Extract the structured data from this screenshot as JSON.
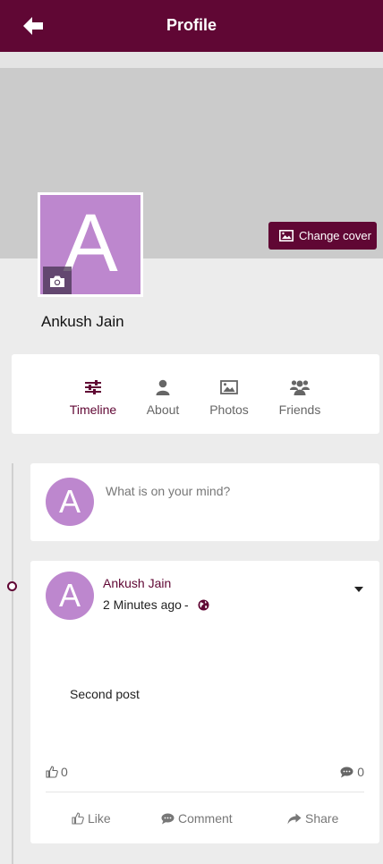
{
  "appbar": {
    "title": "Profile"
  },
  "cover": {
    "change_cover_label": "Change cover"
  },
  "profile": {
    "avatar_letter": "A",
    "name": "Ankush Jain"
  },
  "tabs": [
    {
      "label": "Timeline",
      "icon": "sliders-icon",
      "active": true
    },
    {
      "label": "About",
      "icon": "user-icon",
      "active": false
    },
    {
      "label": "Photos",
      "icon": "image-icon",
      "active": false
    },
    {
      "label": "Friends",
      "icon": "users-icon",
      "active": false
    }
  ],
  "composer": {
    "avatar_letter": "A",
    "placeholder": "What is on your mind?"
  },
  "post": {
    "avatar_letter": "A",
    "author": "Ankush Jain",
    "time": "2 Minutes ago",
    "separator": "-",
    "text": "Second post",
    "likes_count": "0",
    "comments_count": "0",
    "actions": {
      "like": "Like",
      "comment": "Comment",
      "share": "Share"
    }
  },
  "colors": {
    "primary": "#600734",
    "avatar_bg": "#bd87ce",
    "cover_bg": "#cbcbcb",
    "page_bg": "#ececec"
  }
}
